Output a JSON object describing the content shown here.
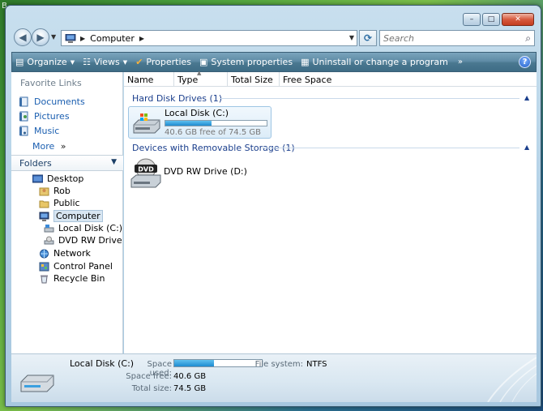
{
  "desktop": {
    "edge_text": "B"
  },
  "window": {
    "caption": {
      "minimize": "–",
      "maximize": "□",
      "close": "✕"
    }
  },
  "address": {
    "crumb": "Computer",
    "search_placeholder": "Search"
  },
  "toolbar": {
    "organize": "Organize",
    "views": "Views",
    "properties": "Properties",
    "system_properties": "System properties",
    "uninstall": "Uninstall or change a program",
    "overflow": "»",
    "help": "?"
  },
  "nav": {
    "favorites_title": "Favorite Links",
    "favorites": [
      "Documents",
      "Pictures",
      "Music"
    ],
    "more": "More",
    "more_arrows": "»",
    "folders_title": "Folders",
    "tree": [
      "Desktop",
      "Rob",
      "Public",
      "Computer",
      "Local Disk (C:)",
      "DVD RW Drive (D:)",
      "Network",
      "Control Panel",
      "Recycle Bin"
    ]
  },
  "columns": {
    "name": "Name",
    "type": "Type",
    "total_size": "Total Size",
    "free_space": "Free Space"
  },
  "groups": {
    "hard_disks": "Hard Disk Drives (1)",
    "removable": "Devices with Removable Storage (1)"
  },
  "drives": {
    "local_disk": {
      "name": "Local Disk (C:)",
      "free_text": "40.6 GB free of 74.5 GB",
      "used_fraction": 0.455
    },
    "dvd": {
      "name": "DVD RW Drive (D:)",
      "label": "DVD"
    }
  },
  "details": {
    "name": "Local Disk (C:)",
    "space_used_label": "Space used:",
    "space_free_label": "Space free:",
    "space_free": "40.6 GB",
    "total_size_label": "Total size:",
    "total_size": "74.5 GB",
    "file_system_label": "File system:",
    "file_system": "NTFS",
    "used_fraction": 0.455
  },
  "colors": {
    "accent": "#1a5eb0",
    "group_header": "#1a3e8c",
    "bar_fill": "#1e8bd0"
  }
}
